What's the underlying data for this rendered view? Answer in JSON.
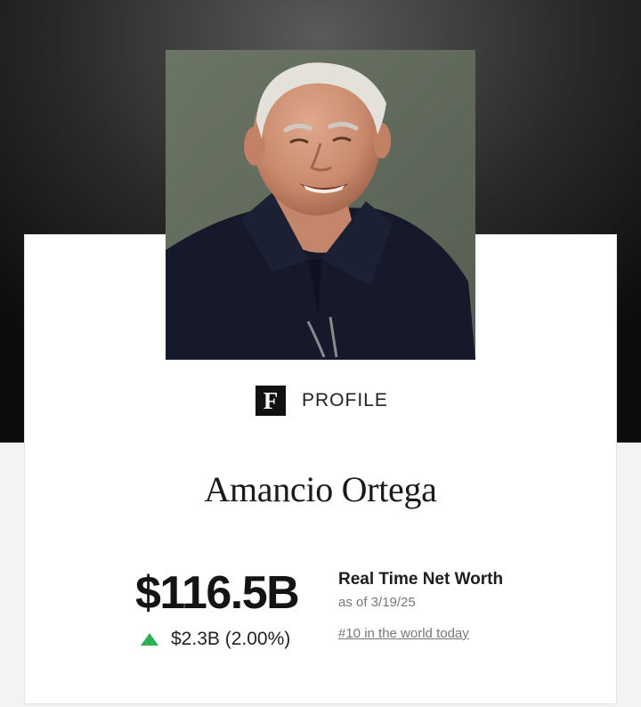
{
  "profile": {
    "logo_letter": "F",
    "label": "PROFILE",
    "name": "Amancio Ortega"
  },
  "net_worth": {
    "value": "$116.5B",
    "change": "$2.3B (2.00%)",
    "change_direction": "up",
    "title": "Real Time Net Worth",
    "as_of": "as of 3/19/25",
    "rank_link": "#10 in the world today"
  },
  "colors": {
    "up": "#2cae55",
    "logo_bg": "#111111",
    "hero_bg": "#1a1a1a"
  },
  "icons": {
    "trend": "triangle-up-icon",
    "logo": "forbes-f-logo"
  }
}
